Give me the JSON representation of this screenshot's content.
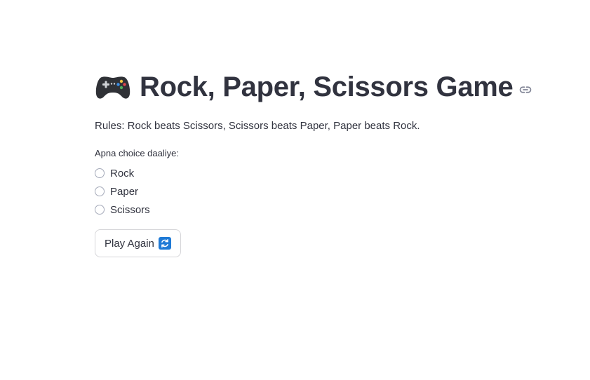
{
  "header": {
    "title": "Rock, Paper, Scissors Game",
    "title_icon": "gamepad-icon",
    "anchor_icon": "link-icon"
  },
  "rules_text": "Rules: Rock beats Scissors, Scissors beats Paper, Paper beats Rock.",
  "choice": {
    "label": "Apna choice daaliye:",
    "options": [
      "Rock",
      "Paper",
      "Scissors"
    ],
    "selected": null
  },
  "play_again": {
    "label": "Play Again",
    "icon": "repeat-icon"
  },
  "colors": {
    "text": "#31333f",
    "accent_icon": "#1f7ad6",
    "radio_border": "#a3a8b8",
    "button_border": "#d6d6d9"
  }
}
